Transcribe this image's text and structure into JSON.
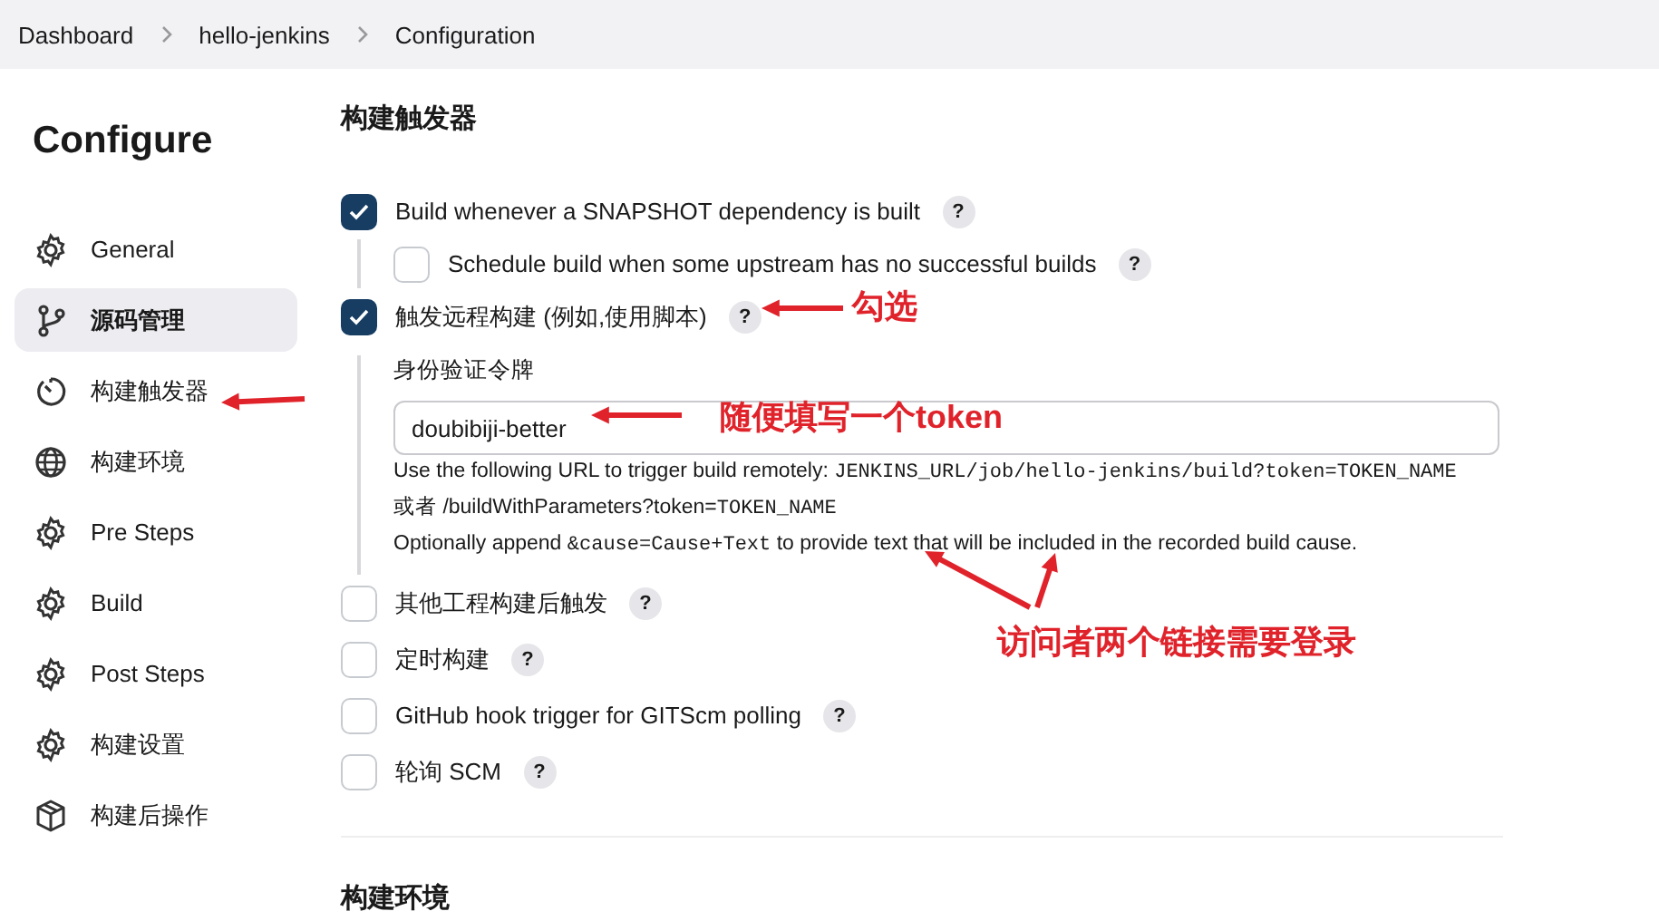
{
  "breadcrumb": [
    "Dashboard",
    "hello-jenkins",
    "Configuration"
  ],
  "sidebar": {
    "title": "Configure",
    "items": [
      {
        "label": "General",
        "selected": false
      },
      {
        "label": "源码管理",
        "selected": true
      },
      {
        "label": "构建触发器",
        "selected": false
      },
      {
        "label": "构建环境",
        "selected": false
      },
      {
        "label": "Pre Steps",
        "selected": false
      },
      {
        "label": "Build",
        "selected": false
      },
      {
        "label": "Post Steps",
        "selected": false
      },
      {
        "label": "构建设置",
        "selected": false
      },
      {
        "label": "构建后操作",
        "selected": false
      }
    ]
  },
  "section": {
    "title": "构建触发器",
    "triggers": [
      {
        "label": "Build whenever a SNAPSHOT dependency is built",
        "checked": true,
        "help": "?",
        "children": [
          {
            "label": "Schedule build when some upstream has no successful builds",
            "checked": false,
            "help": "?"
          }
        ]
      },
      {
        "label": "触发远程构建 (例如,使用脚本)",
        "checked": true,
        "help": "?",
        "token": {
          "label": "身份验证令牌",
          "value": "doubibiji-better",
          "help_lines": [
            [
              {
                "kind": "text",
                "text": "Use the following URL to trigger build remotely: "
              },
              {
                "kind": "code",
                "text": "JENKINS_URL/job/hello-jenkins/build?token=TOKEN_NAME"
              }
            ],
            [
              {
                "kind": "text",
                "text": "或者 /buildWithParameters?token="
              },
              {
                "kind": "code",
                "text": "TOKEN_NAME"
              }
            ],
            [
              {
                "kind": "text",
                "text": "Optionally append "
              },
              {
                "kind": "code",
                "text": "&cause=Cause+Text"
              },
              {
                "kind": "text",
                "text": " to provide text that will be included in the recorded build cause."
              }
            ]
          ]
        }
      },
      {
        "label": "其他工程构建后触发",
        "checked": false,
        "help": "?"
      },
      {
        "label": "定时构建",
        "checked": false,
        "help": "?"
      },
      {
        "label": "GitHub hook trigger for GITScm polling",
        "checked": false,
        "help": "?"
      },
      {
        "label": "轮询 SCM",
        "checked": false,
        "help": "?"
      }
    ]
  },
  "next_section": {
    "title": "构建环境"
  },
  "annotations": [
    "勾选",
    "随便填写一个token",
    "访问者两个链接需要登录"
  ]
}
